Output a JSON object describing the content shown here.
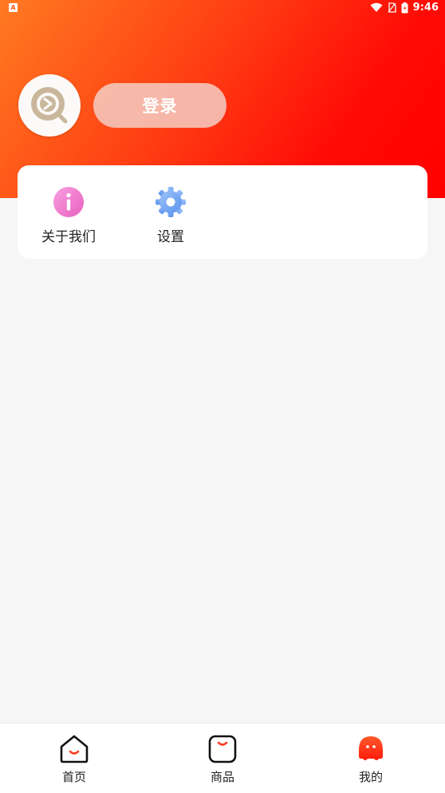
{
  "status_bar": {
    "left_icon": "A",
    "time": "9:46",
    "icons": [
      "wifi-icon",
      "no-sim-icon",
      "battery-icon"
    ]
  },
  "profile": {
    "avatar_icon": "app-logo-icon",
    "login_label": "登录"
  },
  "menu": {
    "items": [
      {
        "label": "关于我们",
        "icon": "info-icon",
        "color": "#f06fc6"
      },
      {
        "label": "设置",
        "icon": "gear-icon",
        "color": "#6fa6f5"
      }
    ]
  },
  "bottom_nav": {
    "items": [
      {
        "label": "首页",
        "icon": "home-icon",
        "active": false
      },
      {
        "label": "商品",
        "icon": "goods-bag-icon",
        "active": false
      },
      {
        "label": "我的",
        "icon": "profile-mascot-icon",
        "active": true
      }
    ]
  },
  "colors": {
    "header_gradient_start": "#ff7a22",
    "header_gradient_end": "#ff0000",
    "active_nav": "#ff3b1f",
    "background": "#f6f6f6"
  }
}
